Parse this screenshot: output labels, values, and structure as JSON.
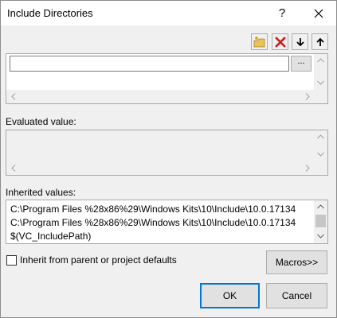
{
  "window": {
    "title": "Include Directories",
    "help_glyph": "?",
    "close_icon": "close-icon"
  },
  "toolbar": {
    "buttons": [
      {
        "name": "new-line-icon"
      },
      {
        "name": "delete-icon"
      },
      {
        "name": "move-down-icon"
      },
      {
        "name": "move-up-icon"
      }
    ],
    "delete_color": "#cc1b1b",
    "folder_color": "#e8c25a"
  },
  "editor": {
    "value": "",
    "browse_label": "..."
  },
  "evaluated": {
    "label": "Evaluated value:"
  },
  "inherited": {
    "label": "Inherited values:",
    "lines": [
      "C:\\Program Files %28x86%29\\Windows Kits\\10\\Include\\10.0.17134",
      "C:\\Program Files %28x86%29\\Windows Kits\\10\\Include\\10.0.17134",
      "$(VC_IncludePath)"
    ]
  },
  "options": {
    "inherit_label": "Inherit from parent or project defaults",
    "inherit_checked": false
  },
  "buttons": {
    "macros": "Macros>>",
    "ok": "OK",
    "cancel": "Cancel"
  },
  "colors": {
    "accent": "#0078d7"
  }
}
